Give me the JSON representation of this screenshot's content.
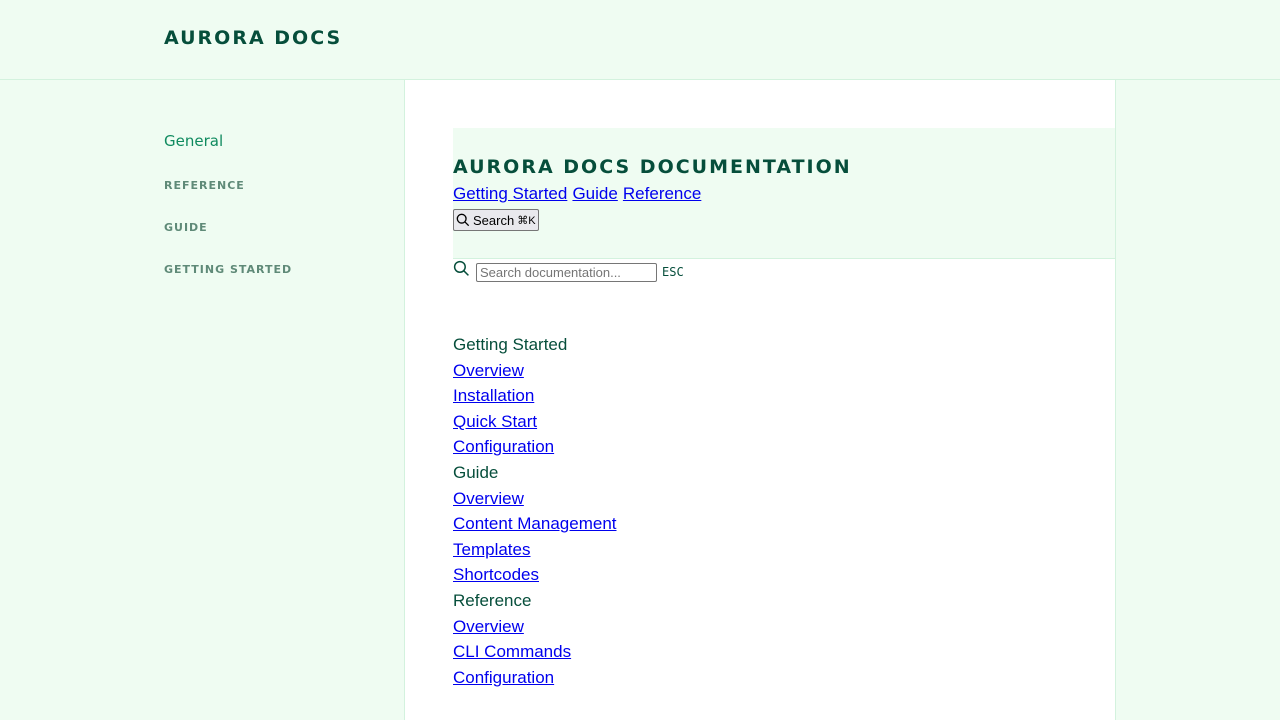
{
  "brand": "AURORA DOCS",
  "sidebar": {
    "general": "General",
    "sections": [
      "REFERENCE",
      "GUIDE",
      "GETTING STARTED"
    ]
  },
  "header": {
    "title": "AURORA DOCS DOCUMENTATION",
    "links": [
      "Getting Started",
      "Guide",
      "Reference"
    ],
    "search_button": "Search",
    "search_shortcut": "⌘K"
  },
  "search": {
    "placeholder": "Search documentation...",
    "esc": "ESC"
  },
  "nav": [
    {
      "heading": "Getting Started",
      "links": [
        "Overview",
        "Installation",
        "Quick Start",
        "Configuration"
      ]
    },
    {
      "heading": "Guide",
      "links": [
        "Overview",
        "Content Management",
        "Templates",
        "Shortcodes"
      ]
    },
    {
      "heading": "Reference",
      "links": [
        "Overview",
        "CLI Commands",
        "Configuration"
      ]
    }
  ],
  "colors": {
    "background": "#effcf2",
    "text": "#064e3b",
    "accent": "#0f8a5f",
    "link": "#0000ee"
  }
}
